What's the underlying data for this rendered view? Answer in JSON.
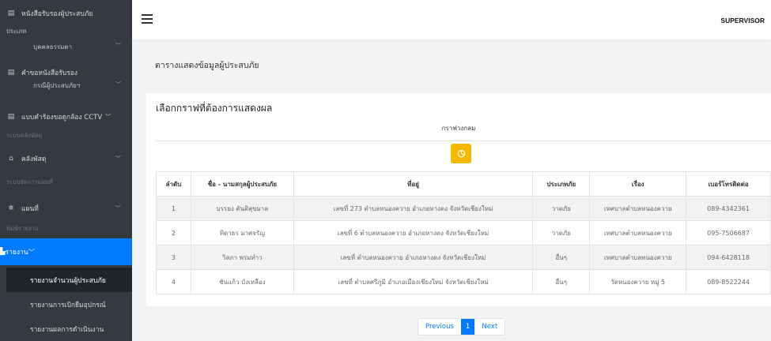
{
  "sidebar": {
    "top_item": "หนังสือรับรองผู้ประสบภัย",
    "top_item_sub": "ประเภท",
    "sub1": "บุคคลธรรมดา",
    "item2": "คำขอหนังสือรับรอง",
    "sub2": "กรณีผู้ประสบภัยฯ",
    "item3": "แบบคำร้องขอดูกล้อง CCTV",
    "header1": "ระบบคลังพัสดุ",
    "item4": "คลังพัสดุ",
    "header2": "ระบบจัดการแผนที่",
    "item5": "แผนที่",
    "header3": "พิมพ์รายงาน",
    "active": "รายงาน",
    "children": [
      "รายงานจำนวนผู้ประสบภัย",
      "รายงานการเบิกยืมอุปกรณ์",
      "รายงานผลการดำเนินงาน"
    ]
  },
  "topbar": {
    "user": "SUPERVISOR"
  },
  "page_title": "ตารางแสดงข้อมูลผู้ประสบภัย",
  "card": {
    "title": "เลือกกราฟที่ต้องการแสดงผล",
    "graph_label": "กราฟวงกลม",
    "headers": [
      "ลำดับ",
      "ชื่อ - นามสกุลผู้ประสบภัย",
      "ที่อยู่",
      "ประเภทภัย",
      "เรื่อง",
      "เบอร์โทรติดต่อ"
    ],
    "rows": [
      [
        "1",
        "บรรยง ตันติสุขมาล",
        "เลขที่ 273 ตำบลหนองควาย อำเภอหางดง จังหวัดเชียงใหม่",
        "วาตภัย",
        "เทศบาลตำบลหนองควาย",
        "089-4342361"
      ],
      [
        "2",
        "ทิดาธร มาศจรัญ",
        "เลขที่ 6 ตำบลหนองควาย อำเภอหางดง จังหวัดเชียงใหม่",
        "วาตภัย",
        "เทศบาลตำบลหนองควาย",
        "095-7506687"
      ],
      [
        "3",
        "วิลภา พรมทำว",
        "เลขที่ ตำบลหนองควาย อำเภอหางดง จังหวัดเชียงใหม่",
        "อื่นๆ",
        "เทศบาลตำบลหนองควาย",
        "094-6428118"
      ],
      [
        "4",
        "ชันแก้ว บังเหลือง",
        "เลขที่ ตำบลศรีภูมิ อำเภอเมืองเชียงใหม่ จังหวัดเชียงใหม่",
        "อื่นๆ",
        "วัดหนองควาย หมู่ 5",
        "089-8522244"
      ]
    ]
  },
  "pagination": {
    "previous": "Previous",
    "page": "1",
    "next": "Next"
  },
  "colors": {
    "sidebar": "#343a40",
    "active": "#007bff",
    "pie_button": "#f5b800"
  }
}
